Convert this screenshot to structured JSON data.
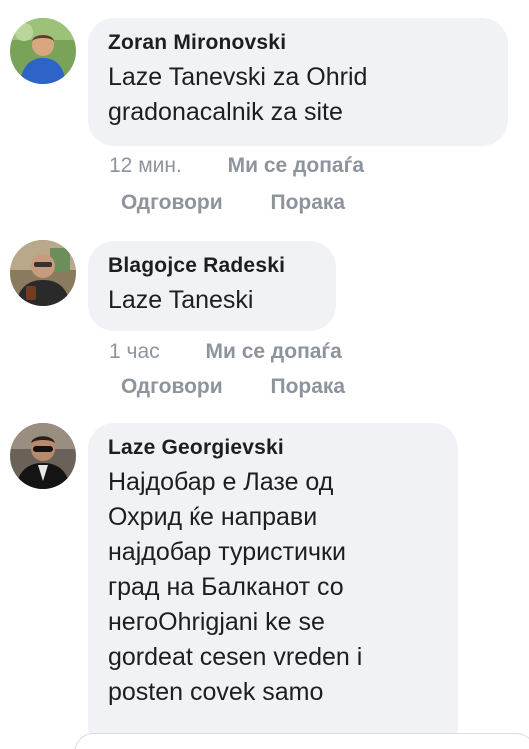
{
  "comments": [
    {
      "author": "Zoran Mironovski",
      "text": "Laze Tanevski za Ohrid\ngradonacalnik za site",
      "time": "12 мин.",
      "like": "Ми се допаѓа",
      "reply": "Одговори",
      "message": "Порака"
    },
    {
      "author": "Blagojce Radeski",
      "text": "Laze Taneski",
      "time": "1 час",
      "like": "Ми се допаѓа",
      "reply": "Одговори",
      "message": "Порака"
    },
    {
      "author": "Laze Georgievski",
      "text": "Најдобар е Лазе од\nОхрид ќе направи\nнајдобар туристички\nград на Балканот со\nнегоOhrigjani ke se\ngordeat cesen vreden i\nposten covek samo"
    }
  ],
  "colors": {
    "bubble": "#f0f2f5",
    "text": "#1c1e21",
    "meta": "#8d949e"
  }
}
